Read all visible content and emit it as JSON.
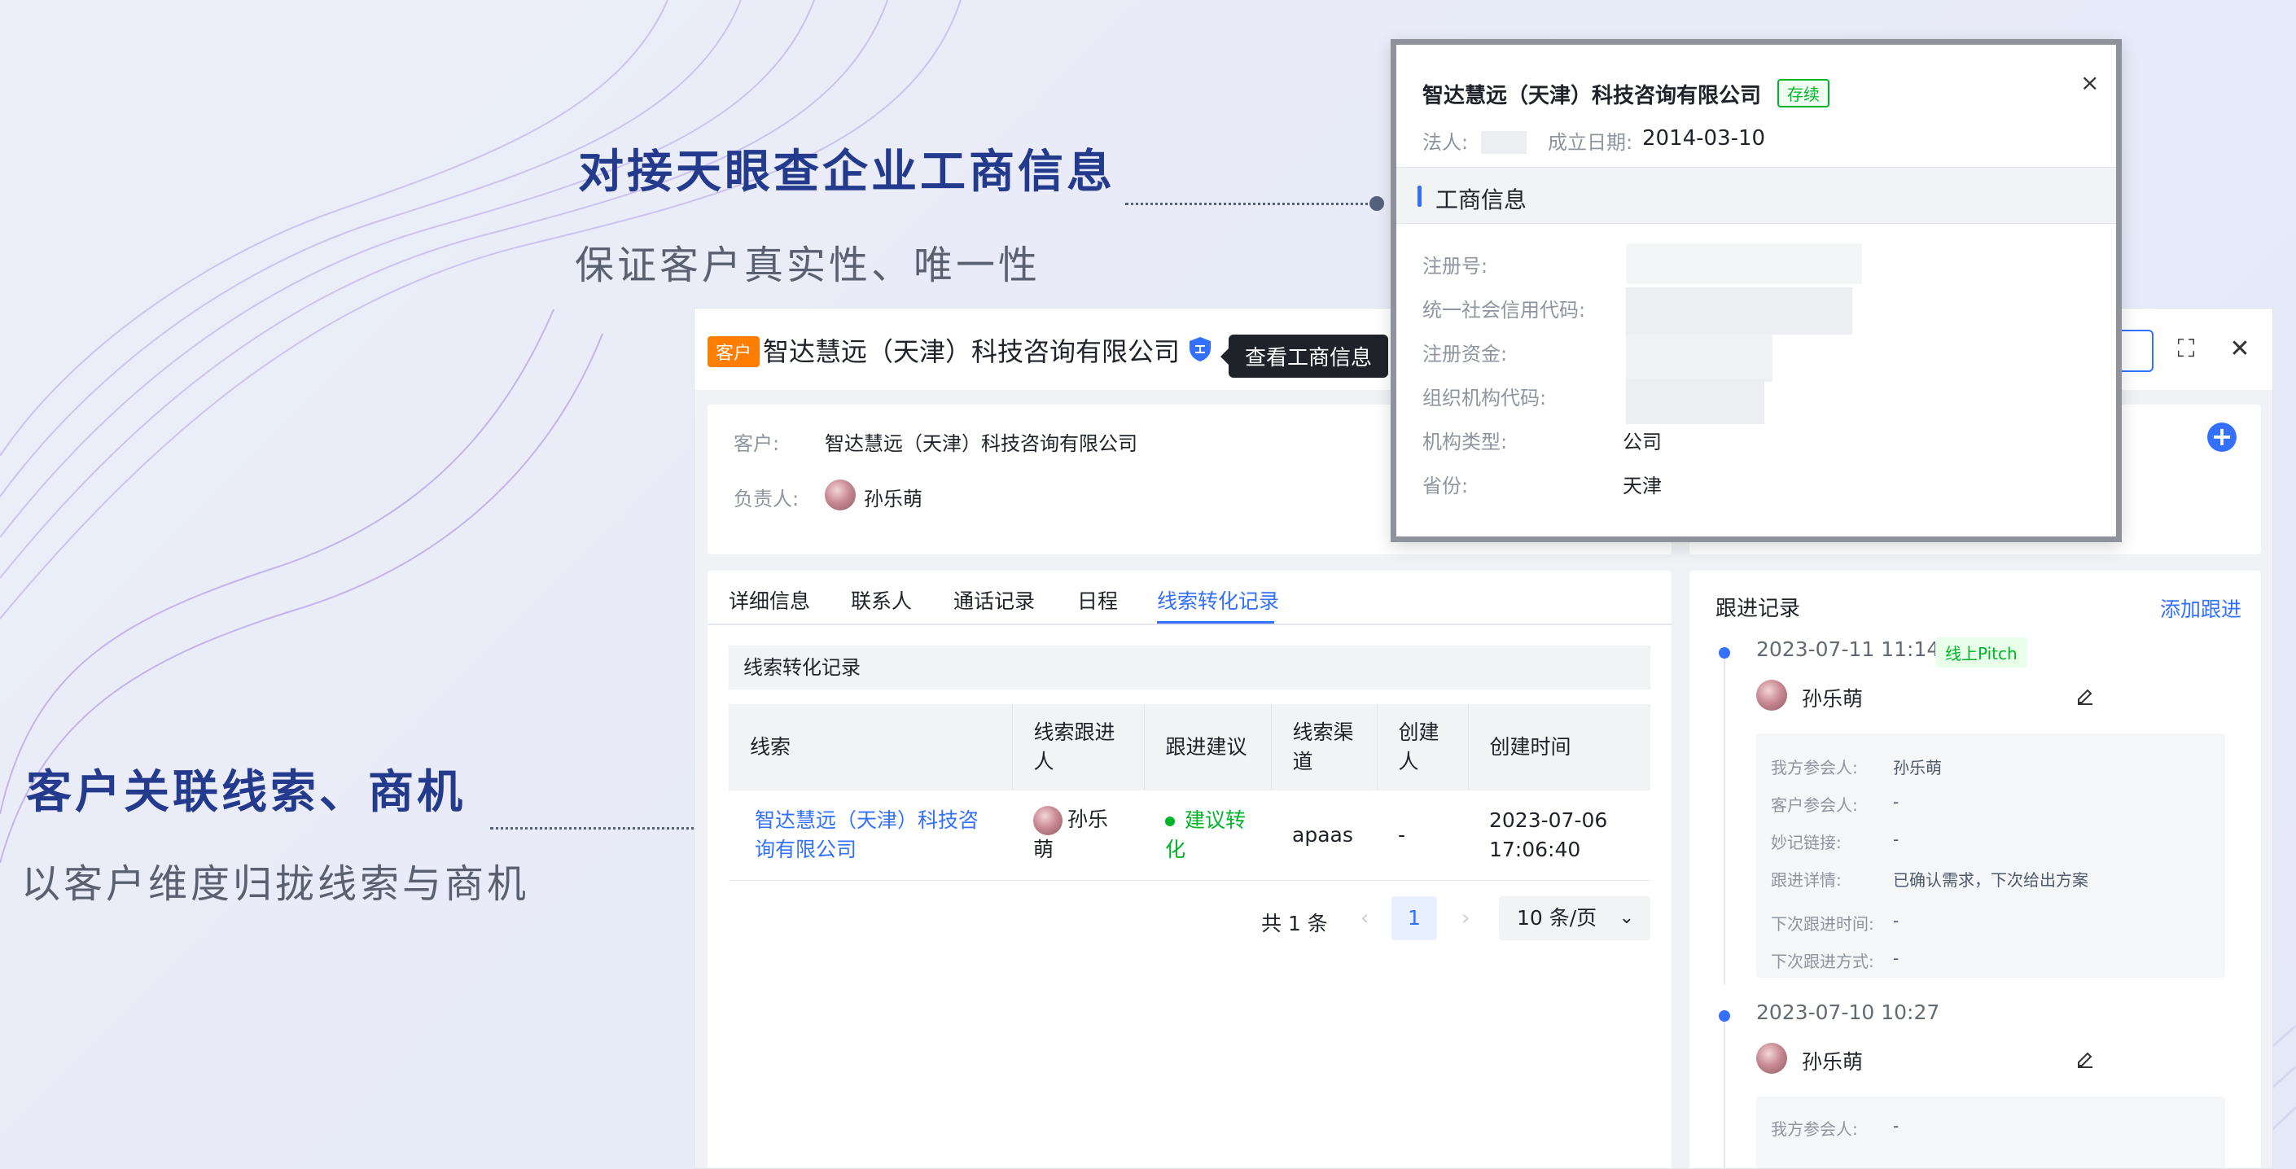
{
  "captions": {
    "top_title": "对接天眼查企业工商信息",
    "top_sub": "保证客户真实性、唯一性",
    "bottom_title": "客户关联线索、商机",
    "bottom_sub": "以客户维度归拢线索与商机"
  },
  "header": {
    "tag": "客户",
    "title": "智达慧远（天津）科技咨询有限公司",
    "tooltip": "查看工商信息"
  },
  "info": {
    "customer_label": "客户:",
    "customer_value": "智达慧远（天津）科技咨询有限公司",
    "owner_label": "负责人:",
    "owner_value": "孙乐萌"
  },
  "tabs": [
    {
      "label": "详细信息"
    },
    {
      "label": "联系人"
    },
    {
      "label": "通话记录"
    },
    {
      "label": "日程"
    },
    {
      "label": "线索转化记录"
    }
  ],
  "section_title": "线索转化记录",
  "table": {
    "headers": [
      "线索",
      "线索跟进人",
      "跟进建议",
      "线索渠道",
      "创建人",
      "创建时间"
    ],
    "rows": [
      {
        "lead": "智达慧远（天津）科技咨询有限公司",
        "follower": "孙乐萌",
        "advice": "建议转化",
        "channel": "apaas",
        "creator": "-",
        "created": "2023-07-06 17:06:40"
      }
    ]
  },
  "pager": {
    "total": "共 1 条",
    "current": "1",
    "page_size": "10 条/页"
  },
  "follow": {
    "title": "跟进记录",
    "add": "添加跟进",
    "entries": [
      {
        "time": "2023-07-11 11:14",
        "badge": "线上Pitch",
        "user": "孙乐萌",
        "fields": [
          {
            "k": "我方参会人:",
            "v": "孙乐萌"
          },
          {
            "k": "客户参会人:",
            "v": "-"
          },
          {
            "k": "妙记链接:",
            "v": "-"
          },
          {
            "k": "跟进详情:",
            "v": "已确认需求，下次给出方案"
          },
          {
            "k": "下次跟进时间:",
            "v": "-"
          },
          {
            "k": "下次跟进方式:",
            "v": "-"
          }
        ]
      },
      {
        "time": "2023-07-10 10:27",
        "user": "孙乐萌",
        "fields": [
          {
            "k": "我方参会人:",
            "v": "-"
          }
        ]
      }
    ]
  },
  "popup": {
    "title": "智达慧远（天津）科技咨询有限公司",
    "status": "存续",
    "legal_label": "法人:",
    "founded_label": "成立日期:",
    "founded_value": "2014-03-10",
    "section": "工商信息",
    "fields": [
      {
        "k": "注册号:",
        "v": ""
      },
      {
        "k": "统一社会信用代码:",
        "v": ""
      },
      {
        "k": "注册资金:",
        "v": ""
      },
      {
        "k": "组织机构代码:",
        "v": ""
      },
      {
        "k": "机构类型:",
        "v": "公司"
      },
      {
        "k": "省份:",
        "v": "天津"
      }
    ]
  },
  "colors": {
    "primary": "#3370ff",
    "caption_title": "#243a8c",
    "tag_orange": "#ff7d00",
    "success": "#00b42a"
  }
}
